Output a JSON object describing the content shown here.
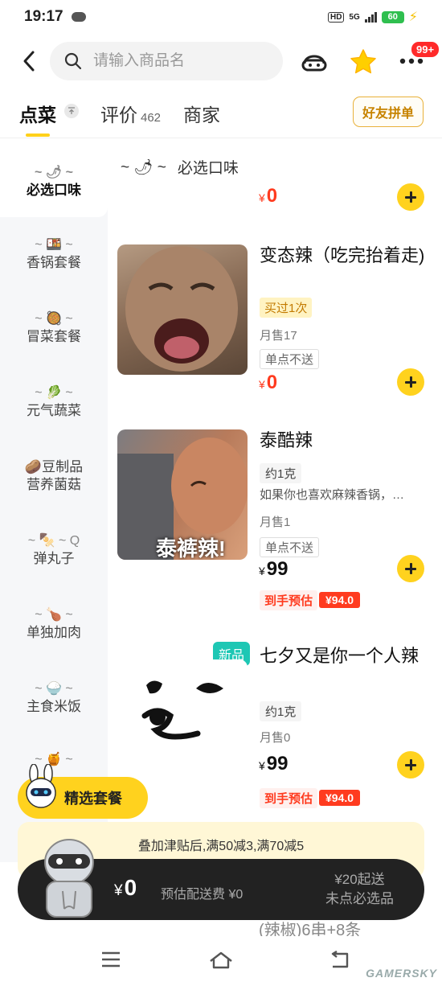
{
  "status": {
    "time": "19:17",
    "hd": "HD",
    "network": "5G",
    "battery": "60"
  },
  "header": {
    "search_placeholder": "请输入商品名",
    "badge": "99+"
  },
  "tabs": {
    "order": "点菜",
    "reviews": "评价",
    "reviews_count": "462",
    "merchant": "商家",
    "group_button": "好友拼单"
  },
  "sidebar": {
    "items": [
      {
        "emoji": "~ 🌶 ~",
        "label": "必选口味"
      },
      {
        "emoji": "~ 🍱 ~",
        "label": "香锅套餐"
      },
      {
        "emoji": "~ 🥘 ~",
        "label": "冒菜套餐"
      },
      {
        "emoji": "~ 🥬 ~",
        "label": "元气蔬菜"
      },
      {
        "emoji": "🥔",
        "label": "豆制品",
        "label2": "营养菌菇"
      },
      {
        "emoji": "~ 🍢 ~ Q",
        "label": "弹丸子"
      },
      {
        "emoji": "~ 🍗 ~",
        "label": "单独加肉"
      },
      {
        "emoji": "~ 🍚 ~",
        "label": "主食米饭"
      },
      {
        "emoji": "~ 🍯 ~",
        "label": ""
      }
    ]
  },
  "section": {
    "title": "必选口味",
    "emoji": "~ 🌶 ~",
    "price": "0",
    "currency": "¥"
  },
  "products": [
    {
      "name": "变态辣（吃完抬着走)",
      "tag": "买过1次",
      "sales": "月售17",
      "limit": "单点不送",
      "price": "0",
      "currency": "¥"
    },
    {
      "name": "泰酷辣",
      "spec": "约1克",
      "desc": "如果你也喜欢麻辣香锅，…",
      "sales": "月售1",
      "limit": "单点不送",
      "price": "99",
      "currency": "¥",
      "est_label": "到手预估",
      "est_value": "¥94.0",
      "img_caption": "泰裤辣!"
    },
    {
      "name": "七夕又是你一个人辣",
      "badge": "新品",
      "spec": "约1克",
      "sales": "月售0",
      "price": "99",
      "currency": "¥",
      "est_label": "到手预估",
      "est_value": "¥94.0"
    }
  ],
  "bottom": {
    "combo_label": "精选套餐",
    "promo": "叠加津贴后,满50减3,满70减5",
    "cart_currency": "¥",
    "cart_total": "0",
    "delivery_fee": "预估配送费 ¥0",
    "min_order": "¥20起送",
    "missing_required": "未点必选品"
  },
  "watermark": "GAMERSKY",
  "under_text": "(辣椒)6串+8条"
}
